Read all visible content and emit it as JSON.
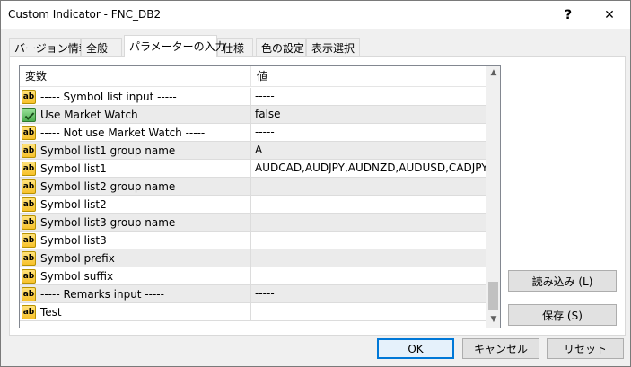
{
  "window": {
    "title": "Custom Indicator - FNC_DB2",
    "help_glyph": "?",
    "close_glyph": "✕"
  },
  "tabs": [
    {
      "label": "バージョン情報",
      "active": false
    },
    {
      "label": "全般",
      "active": false
    },
    {
      "label": "パラメーターの入力",
      "active": true
    },
    {
      "label": "仕様",
      "active": false
    },
    {
      "label": "色の設定",
      "active": false
    },
    {
      "label": "表示選択",
      "active": false
    }
  ],
  "table": {
    "header_name": "変数",
    "header_value": "値",
    "rows": [
      {
        "icon": "ab-icon",
        "name": "----- Symbol list input -----",
        "value": "-----"
      },
      {
        "icon": "bool-icon",
        "name": "Use Market Watch",
        "value": "false"
      },
      {
        "icon": "ab-icon",
        "name": "----- Not use Market Watch -----",
        "value": "-----"
      },
      {
        "icon": "ab-icon",
        "name": "Symbol list1 group name",
        "value": "A"
      },
      {
        "icon": "ab-icon",
        "name": "Symbol list1",
        "value": "AUDCAD,AUDJPY,AUDNZD,AUDUSD,CADJPY,..."
      },
      {
        "icon": "ab-icon",
        "name": "Symbol list2 group name",
        "value": ""
      },
      {
        "icon": "ab-icon",
        "name": "Symbol list2",
        "value": ""
      },
      {
        "icon": "ab-icon",
        "name": "Symbol list3 group name",
        "value": ""
      },
      {
        "icon": "ab-icon",
        "name": "Symbol list3",
        "value": ""
      },
      {
        "icon": "ab-icon",
        "name": "Symbol prefix",
        "value": ""
      },
      {
        "icon": "ab-icon",
        "name": "Symbol suffix",
        "value": ""
      },
      {
        "icon": "ab-icon",
        "name": "----- Remarks input -----",
        "value": "-----"
      },
      {
        "icon": "ab-icon",
        "name": "Test",
        "value": ""
      }
    ]
  },
  "icons": {
    "ab_label": "ab",
    "scroll_up": "▲",
    "scroll_down": "▼"
  },
  "buttons": {
    "load": "読み込み (L)",
    "save": "保存 (S)",
    "ok": "OK",
    "cancel": "キャンセル",
    "reset": "リセット"
  },
  "colors": {
    "accent": "#0078d7",
    "alt_row": "#ebebeb"
  }
}
